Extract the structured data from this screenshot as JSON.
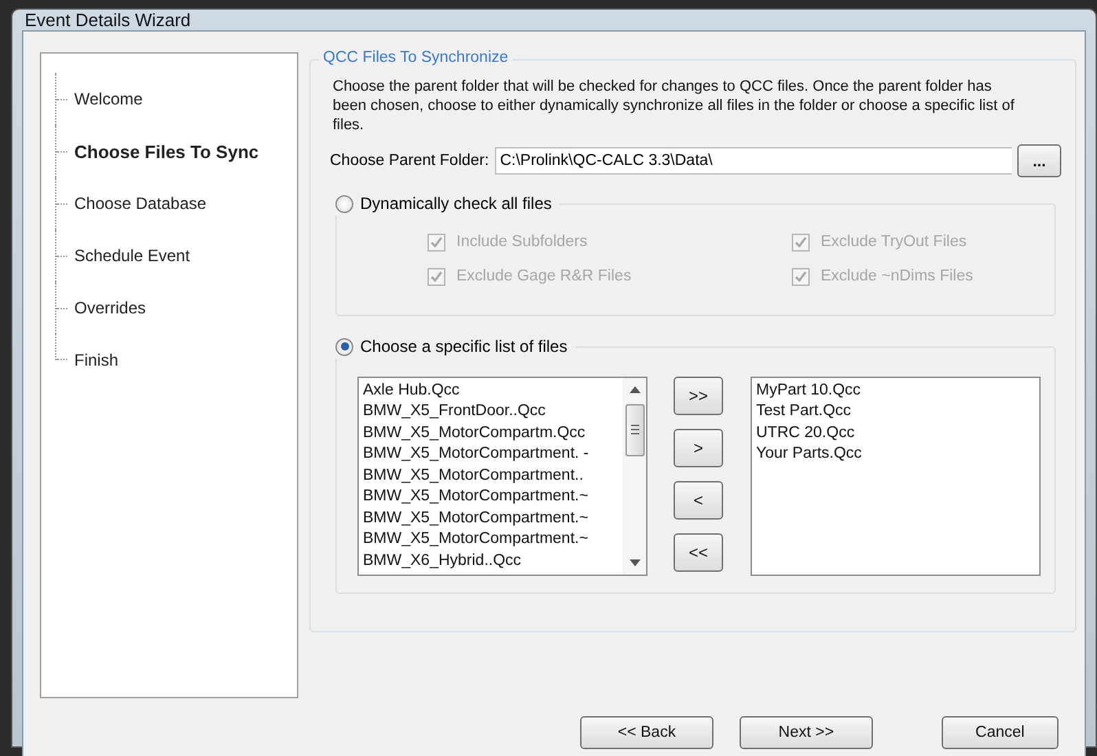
{
  "window": {
    "title": "Event Details Wizard"
  },
  "steps": [
    {
      "label": "Welcome",
      "selected": false
    },
    {
      "label": "Choose Files To Sync",
      "selected": true
    },
    {
      "label": "Choose Database",
      "selected": false
    },
    {
      "label": "Schedule Event",
      "selected": false
    },
    {
      "label": "Overrides",
      "selected": false
    },
    {
      "label": "Finish",
      "selected": false
    }
  ],
  "section": {
    "title": "QCC Files To Synchronize",
    "description": "Choose the parent folder that will be checked for changes to QCC files. Once the parent folder has been chosen, choose to either dynamically synchronize all files in the folder or choose a specific list of files.",
    "folder_label": "Choose Parent Folder:",
    "folder_value": "C:\\Prolink\\QC-CALC 3.3\\Data\\",
    "browse_button": "..."
  },
  "modes": [
    {
      "label": "Dynamically check all files",
      "selected": false,
      "options": [
        {
          "label": "Include Subfolders",
          "checked": true,
          "disabled": true
        },
        {
          "label": "Exclude TryOut Files",
          "checked": true,
          "disabled": true
        },
        {
          "label": "Exclude Gage R&R Files",
          "checked": true,
          "disabled": true
        },
        {
          "label": "Exclude ~nDims Files",
          "checked": true,
          "disabled": true
        }
      ]
    },
    {
      "label": "Choose a specific list of files",
      "selected": true
    }
  ],
  "available_files": [
    "Axle Hub.Qcc",
    "BMW_X5_FrontDoor..Qcc",
    "BMW_X5_MotorCompartm.Qcc",
    "BMW_X5_MotorCompartment. -",
    "BMW_X5_MotorCompartment..",
    "BMW_X5_MotorCompartment.~",
    "BMW_X5_MotorCompartment.~",
    "BMW_X5_MotorCompartment.~",
    "BMW_X6_Hybrid..Qcc"
  ],
  "transfer_buttons": [
    ">>",
    ">",
    "<",
    "<<"
  ],
  "selected_files": [
    "MyPart 10.Qcc",
    "Test Part.Qcc",
    "UTRC 20.Qcc",
    "Your Parts.Qcc"
  ],
  "buttons": [
    "<< Back",
    "Next >>",
    "Cancel"
  ]
}
